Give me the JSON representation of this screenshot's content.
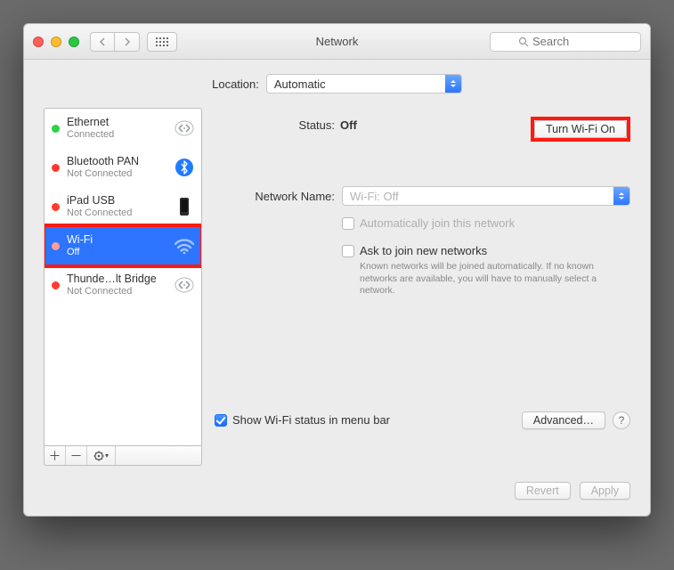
{
  "window": {
    "title": "Network"
  },
  "toolbar": {
    "search_placeholder": "Search"
  },
  "location": {
    "label": "Location:",
    "value": "Automatic"
  },
  "sidebar": {
    "items": [
      {
        "name": "Ethernet",
        "sub": "Connected",
        "status": "green",
        "icon": "ethernet",
        "selected": false
      },
      {
        "name": "Bluetooth PAN",
        "sub": "Not Connected",
        "status": "red",
        "icon": "bluetooth",
        "selected": false
      },
      {
        "name": "iPad USB",
        "sub": "Not Connected",
        "status": "red",
        "icon": "device",
        "selected": false
      },
      {
        "name": "Wi-Fi",
        "sub": "Off",
        "status": "red",
        "icon": "wifi",
        "selected": true
      },
      {
        "name": "Thunde…lt Bridge",
        "sub": "Not Connected",
        "status": "red",
        "icon": "ethernet",
        "selected": false
      }
    ]
  },
  "detail": {
    "status_label": "Status:",
    "status_value": "Off",
    "turn_on_label": "Turn Wi-Fi On",
    "network_name_label": "Network Name:",
    "network_name_value": "Wi-Fi: Off",
    "auto_join_label": "Automatically join this network",
    "ask_join_label": "Ask to join new networks",
    "ask_join_hint": "Known networks will be joined automatically. If no known networks are available, you will have to manually select a network.",
    "menu_bar_label": "Show Wi-Fi status in menu bar",
    "advanced_label": "Advanced…"
  },
  "footer": {
    "revert": "Revert",
    "apply": "Apply"
  }
}
